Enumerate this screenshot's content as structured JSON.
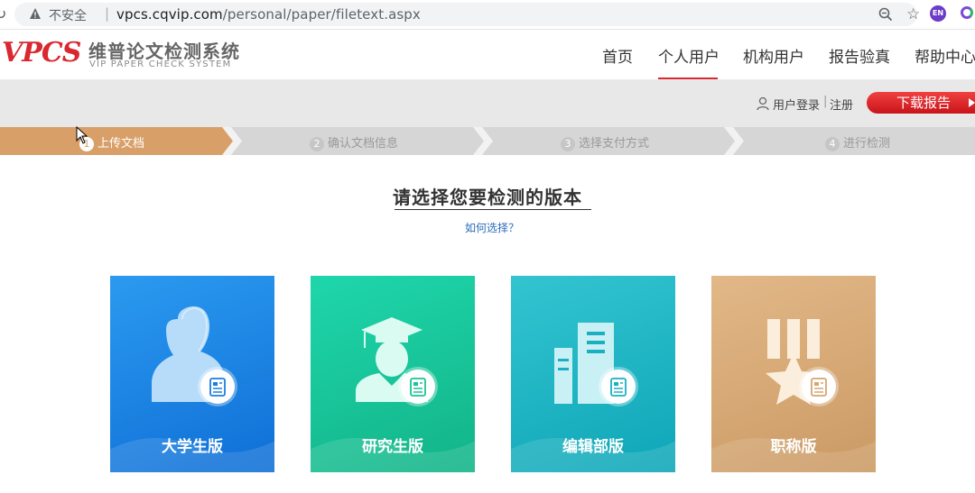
{
  "browser": {
    "not_secure": "不安全",
    "url_domain": "vpcs.cqvip.com",
    "url_path": "/personal/paper/filetext.aspx",
    "extension_label": "EN"
  },
  "header": {
    "logo_text": "VPCS",
    "logo_cn": "维普论文检测系统",
    "logo_en": "VIP PAPER CHECK SYSTEM",
    "nav": [
      "首页",
      "个人用户",
      "机构用户",
      "报告验真",
      "帮助中心"
    ],
    "active_nav": "个人用户"
  },
  "user_bar": {
    "login": "用户登录",
    "separator": "|",
    "register": "注册",
    "download": "下载报告"
  },
  "steps": [
    {
      "num": "1",
      "label": "上传文档",
      "active": true
    },
    {
      "num": "2",
      "label": "确认文档信息",
      "active": false
    },
    {
      "num": "3",
      "label": "选择支付方式",
      "active": false
    },
    {
      "num": "4",
      "label": "进行检测",
      "active": false
    }
  ],
  "main": {
    "title": "请选择您要检测的版本",
    "how_link": "如何选择？"
  },
  "cards": [
    {
      "label": "大学生版",
      "icon": "person-icon",
      "color": "#1a7fe0"
    },
    {
      "label": "研究生版",
      "icon": "graduate-icon",
      "color": "#19c496"
    },
    {
      "label": "编辑部版",
      "icon": "building-icon",
      "color": "#1ab0c2"
    },
    {
      "label": "职称版",
      "icon": "medal-icon",
      "color": "#d5a572"
    }
  ],
  "colors": {
    "brand_red": "#d9282f",
    "step_active": "#d8a068",
    "step_inactive": "#d6d6d6",
    "link": "#2b6cb8"
  }
}
